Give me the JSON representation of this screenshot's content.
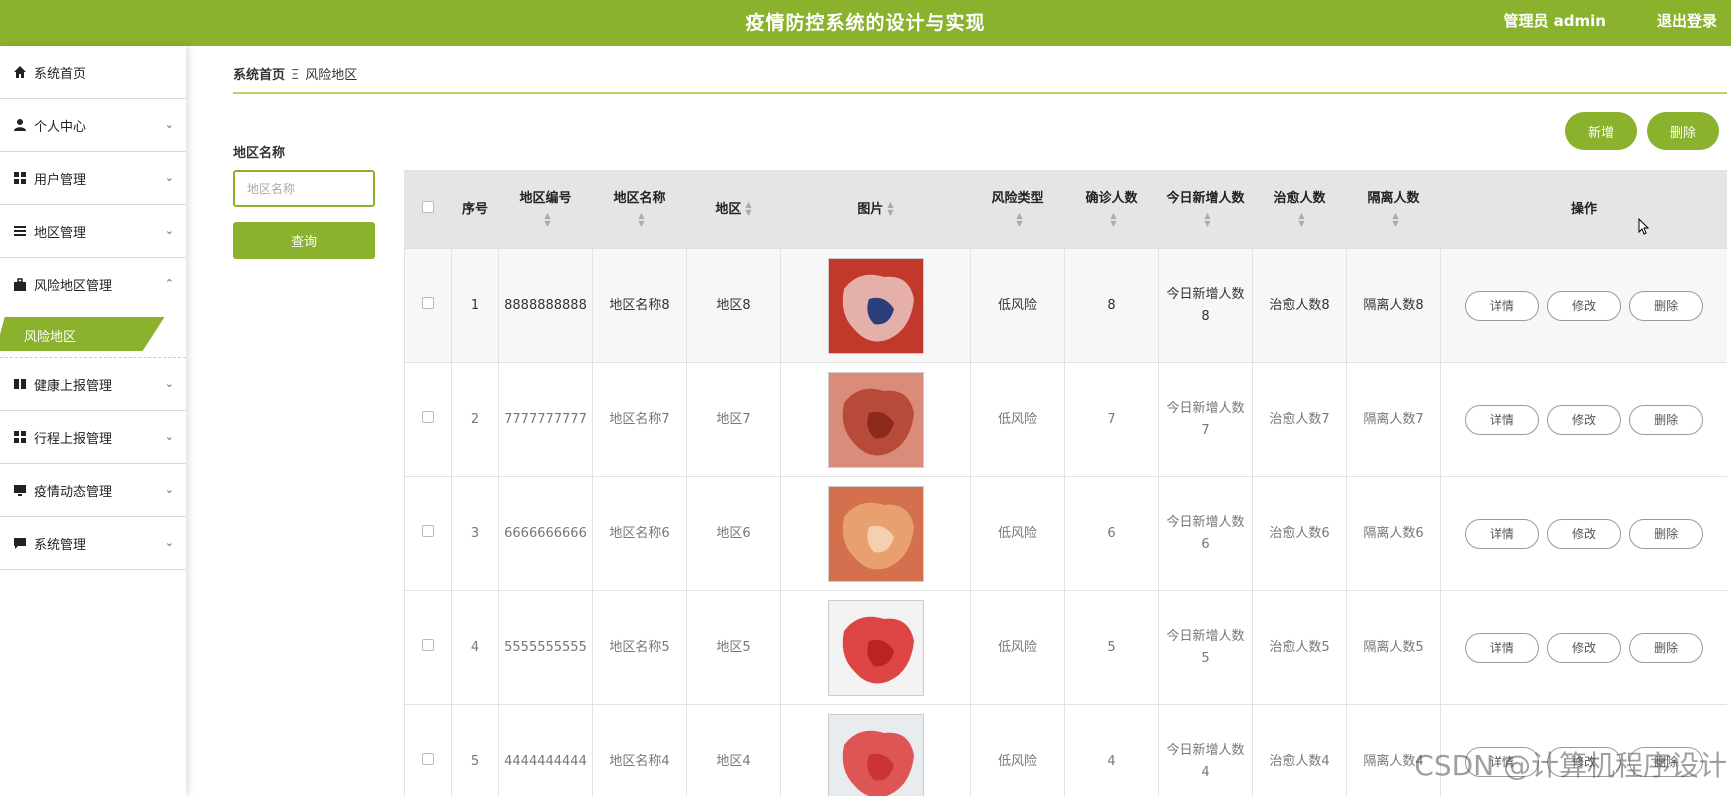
{
  "header": {
    "title": "疫情防控系统的设计与实现",
    "user": "管理员 admin",
    "logout": "退出登录"
  },
  "sidebar": {
    "items": [
      {
        "label": "系统首页",
        "icon": "home-icon",
        "chevron": ""
      },
      {
        "label": "个人中心",
        "icon": "user-icon",
        "chevron": "⌄"
      },
      {
        "label": "用户管理",
        "icon": "grid-icon",
        "chevron": "⌄"
      },
      {
        "label": "地区管理",
        "icon": "list-icon",
        "chevron": "⌄"
      },
      {
        "label": "风险地区管理",
        "icon": "briefcase-icon",
        "chevron": "⌃"
      }
    ],
    "active_sub": "风险地区",
    "items2": [
      {
        "label": "健康上报管理",
        "icon": "book-icon",
        "chevron": "⌄"
      },
      {
        "label": "行程上报管理",
        "icon": "grid-icon",
        "chevron": "⌄"
      },
      {
        "label": "疫情动态管理",
        "icon": "monitor-icon",
        "chevron": "⌄"
      },
      {
        "label": "系统管理",
        "icon": "chat-icon",
        "chevron": "⌄"
      }
    ]
  },
  "breadcrumb": {
    "home": "系统首页",
    "sep": "Ξ",
    "current": "风险地区"
  },
  "search": {
    "label": "地区名称",
    "placeholder": "地区名称",
    "button": "查询"
  },
  "actions": {
    "add": "新增",
    "delete": "删除"
  },
  "table": {
    "headers": [
      "序号",
      "地区编号",
      "地区名称",
      "地区",
      "图片",
      "风险类型",
      "确诊人数",
      "今日新增人数",
      "治愈人数",
      "隔离人数",
      "操作"
    ],
    "row_actions": {
      "detail": "详情",
      "edit": "修改",
      "delete": "删除"
    },
    "rows": [
      {
        "no": "1",
        "code": "8888888888",
        "name": "地区名称8",
        "region": "地区8",
        "risk": "低风险",
        "confirmed": "8",
        "new_today": "今日新增人数8",
        "cured": "治愈人数8",
        "isolated": "隔离人数8"
      },
      {
        "no": "2",
        "code": "7777777777",
        "name": "地区名称7",
        "region": "地区7",
        "risk": "低风险",
        "confirmed": "7",
        "new_today": "今日新增人数7",
        "cured": "治愈人数7",
        "isolated": "隔离人数7"
      },
      {
        "no": "3",
        "code": "6666666666",
        "name": "地区名称6",
        "region": "地区6",
        "risk": "低风险",
        "confirmed": "6",
        "new_today": "今日新增人数6",
        "cured": "治愈人数6",
        "isolated": "隔离人数6"
      },
      {
        "no": "4",
        "code": "5555555555",
        "name": "地区名称5",
        "region": "地区5",
        "risk": "低风险",
        "confirmed": "5",
        "new_today": "今日新增人数5",
        "cured": "治愈人数5",
        "isolated": "隔离人数5"
      },
      {
        "no": "5",
        "code": "4444444444",
        "name": "地区名称4",
        "region": "地区4",
        "risk": "低风险",
        "confirmed": "4",
        "new_today": "今日新增人数4",
        "cured": "治愈人数4",
        "isolated": "隔离人数4"
      }
    ]
  },
  "watermark": "CSDN @计算机程序设计",
  "colors": {
    "accent": "#8ab22c"
  }
}
